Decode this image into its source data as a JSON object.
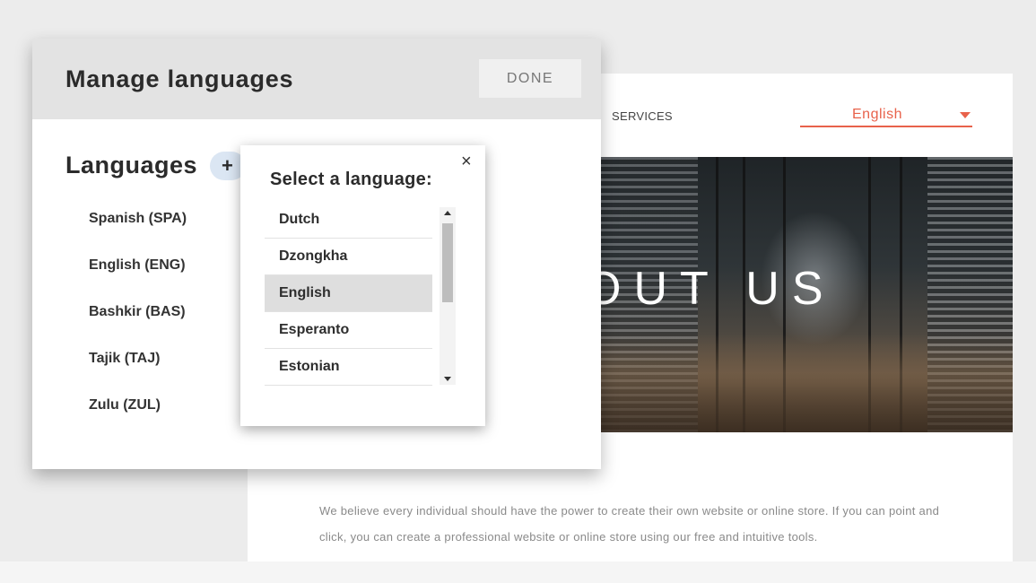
{
  "site": {
    "nav_services": "SERVICES",
    "language_select": {
      "value": "English",
      "accent": "#e8624b"
    },
    "hero_title": "OUT US",
    "about_text": "We believe every individual should have the power to create their own website or online store. If you can point and click, you can create a professional website or online store using our free and intuitive tools."
  },
  "panel": {
    "title": "Manage languages",
    "done_label": "DONE",
    "languages_heading": "Languages",
    "add_label": "+",
    "languages": [
      "Spanish (SPA)",
      "English (ENG)",
      "Bashkir (BAS)",
      "Tajik (TAJ)",
      "Zulu (ZUL)"
    ]
  },
  "popup": {
    "title": "Select a language:",
    "close_label": "×",
    "options": [
      "Dutch",
      "Dzongkha",
      "English",
      "Esperanto",
      "Estonian"
    ],
    "selected": "English"
  }
}
